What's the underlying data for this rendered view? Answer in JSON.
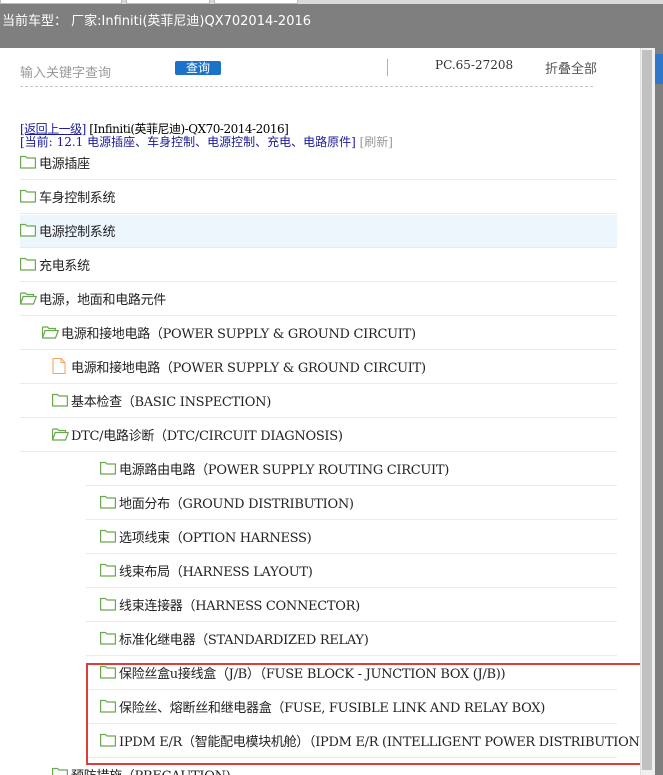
{
  "header": {
    "title": "当前车型： 厂家:Infiniti(英菲尼迪)QX702014-2016"
  },
  "search": {
    "placeholder": "输入关键字查询",
    "button_label": "查询",
    "code": "PC.65-27208",
    "collapse_label": "折叠全部"
  },
  "breadcrumb": {
    "back_label": "[返回上一级]",
    "model": "[Infiniti(英菲尼迪)-QX70-2014-2016]",
    "current_label": "[当前:",
    "current_path": "12.1 电源插座、车身控制、电源控制、充电、电路原件]",
    "refresh_label": "[刷新]"
  },
  "tree": [
    {
      "label": "电源插座",
      "icon": "folder-icon"
    },
    {
      "label": "车身控制系统",
      "icon": "folder-icon"
    },
    {
      "label": "电源控制系统",
      "icon": "folder-icon",
      "highlighted": true
    },
    {
      "label": "充电系统",
      "icon": "folder-icon"
    },
    {
      "label": "电源，地面和电路元件",
      "icon": "folder-open-icon"
    },
    {
      "label": "电源和接地电路（POWER SUPPLY & GROUND CIRCUIT)",
      "icon": "folder-open-icon"
    },
    {
      "label": "电源和接地电路（POWER SUPPLY & GROUND CIRCUIT)",
      "icon": "document-icon"
    },
    {
      "label": "基本检查（BASIC INSPECTION)",
      "icon": "folder-icon"
    },
    {
      "label": "DTC/电路诊断（DTC/CIRCUIT DIAGNOSIS)",
      "icon": "folder-open-icon"
    },
    {
      "label": "电源路由电路（POWER SUPPLY ROUTING CIRCUIT)",
      "icon": "folder-icon"
    },
    {
      "label": "地面分布（GROUND DISTRIBUTION)",
      "icon": "folder-icon"
    },
    {
      "label": "选项线束（OPTION HARNESS)",
      "icon": "folder-icon"
    },
    {
      "label": "线束布局（HARNESS LAYOUT)",
      "icon": "folder-icon"
    },
    {
      "label": "线束连接器（HARNESS CONNECTOR)",
      "icon": "folder-icon"
    },
    {
      "label": "标准化继电器（STANDARDIZED RELAY)",
      "icon": "folder-icon"
    },
    {
      "label": "保险丝盒u接线盒（J/B）（FUSE BLOCK - JUNCTION BOX (J/B))",
      "icon": "folder-icon"
    },
    {
      "label": "保险丝、熔断丝和继电器盒（FUSE, FUSIBLE LINK AND RELAY BOX)",
      "icon": "folder-icon"
    },
    {
      "label": "IPDM E/R（智能配电模块机舱）（IPDM E/R (INTELLIGENT POWER DISTRIBUTION MOD",
      "icon": "folder-icon"
    },
    {
      "label": "预防措施（PRECAUTION)",
      "icon": "folder-icon"
    }
  ],
  "colors": {
    "folder": "#6aa84f",
    "document": "#f0a35e",
    "highlight_box": "#e03c3c",
    "query_button": "#1a73c9"
  }
}
